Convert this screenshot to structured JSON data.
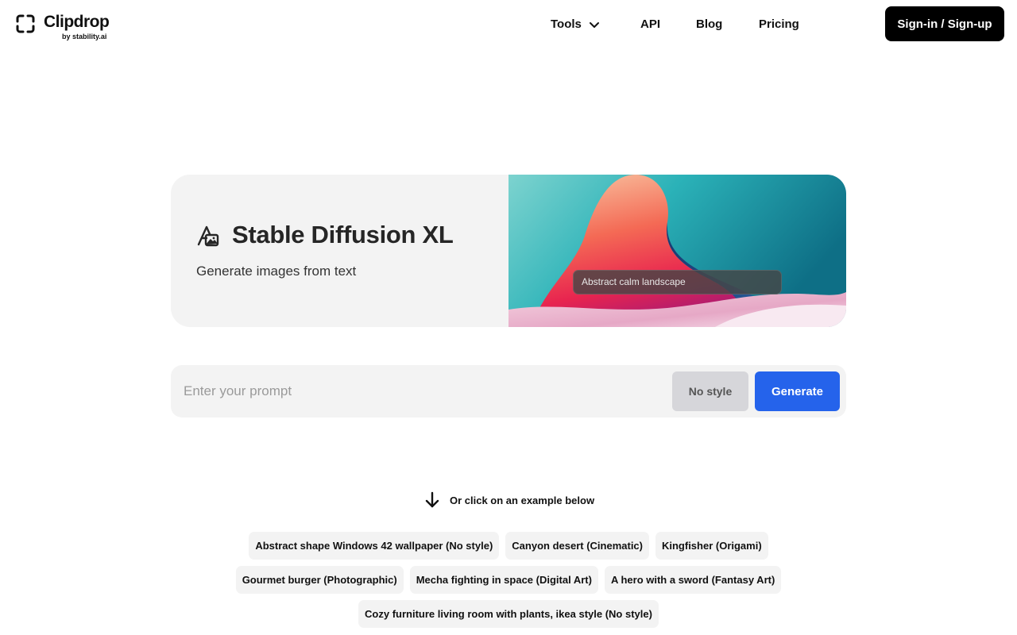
{
  "header": {
    "logo_text": "Clipdrop",
    "logo_sub": "by stability.ai",
    "nav": {
      "tools": "Tools",
      "api": "API",
      "blog": "Blog",
      "pricing": "Pricing"
    },
    "signin_label": "Sign-in / Sign-up"
  },
  "hero": {
    "icon": "image-generate-icon",
    "title": "Stable Diffusion XL",
    "subtitle": "Generate images from text",
    "image_prompt": "Abstract calm landscape"
  },
  "prompt": {
    "placeholder": "Enter your prompt",
    "value": "",
    "style_label": "No style",
    "generate_label": "Generate"
  },
  "examples": {
    "hint": "Or click on an example below",
    "hint_icon": "arrow-down-icon",
    "rows": [
      [
        "Abstract shape Windows 42 wallpaper (No style)",
        "Canyon desert (Cinematic)",
        "Kingfisher (Origami)"
      ],
      [
        "Gourmet burger (Photographic)",
        "Mecha fighting in space (Digital Art)",
        "A hero with a sword (Fantasy Art)"
      ],
      [
        "Cozy furniture living room with plants, ikea style (No style)"
      ]
    ]
  },
  "colors": {
    "accent": "#2563eb",
    "card_bg": "#f3f3f3",
    "signin_bg": "#000000"
  }
}
